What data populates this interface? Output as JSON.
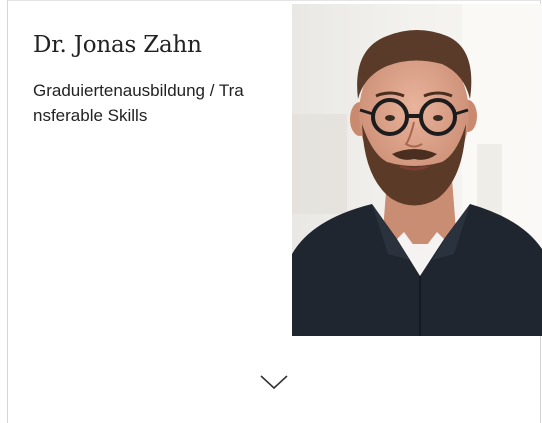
{
  "person": {
    "name": "Dr. Jonas Zahn",
    "role": "Graduiertenausbildung / Transferable Skills"
  },
  "photo": {
    "subject": "portrait-photo"
  },
  "expand": {
    "icon": "chevron-down-icon"
  },
  "colors": {
    "text": "#222222",
    "border": "#d6d6d6",
    "background": "#ffffff"
  }
}
